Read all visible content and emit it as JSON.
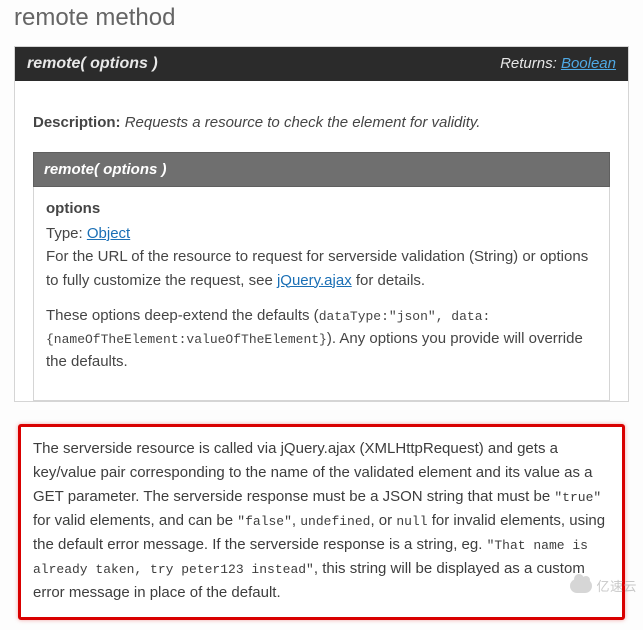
{
  "title": "remote method",
  "header": {
    "signature": "remote( options )",
    "returnsLabel": "Returns:",
    "returnsType": "Boolean"
  },
  "descriptionLabel": "Description:",
  "descriptionText": "Requests a resource to check the element for validity.",
  "options": {
    "headerSignature": "remote( options )",
    "paramName": "options",
    "typeLabel": "Type:",
    "typeLink": "Object",
    "para1_a": "For the URL of the resource to request for serverside validation (String) or options to fully customize the request, see ",
    "para1_link": "jQuery.ajax",
    "para1_b": " for details.",
    "para2_a": "These options deep-extend the defaults (",
    "para2_code": "dataType:\"json\", data:{nameOfTheElement:valueOfTheElement}",
    "para2_b": "). Any options you provide will override the defaults."
  },
  "highlight": {
    "t1": "The serverside resource is called via jQuery.ajax (XMLHttpRequest) and gets a key/value pair corresponding to the name of the validated element and its value as a GET parameter. The serverside response must be a JSON string that must be ",
    "c1": "\"true\"",
    "t2": " for valid elements, and can be ",
    "c2": "\"false\"",
    "t3": ", ",
    "c3": "undefined",
    "t4": ", or ",
    "c4": "null",
    "t5": " for invalid elements, using the default error message. If the serverside response is a string, eg. ",
    "c5": "\"That name is already taken, try peter123 instead\"",
    "t6": ", this string will be displayed as a custom error message in place of the default."
  },
  "watermark": "亿速云"
}
